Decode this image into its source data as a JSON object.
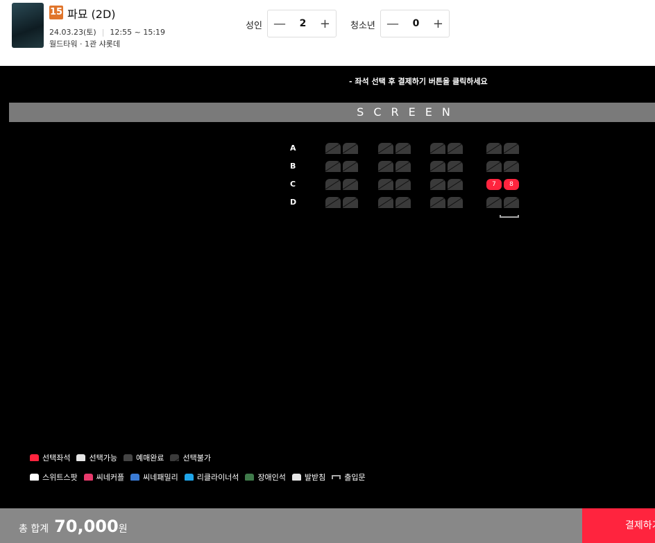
{
  "movie": {
    "rating": "15",
    "title": "파묘 (2D)",
    "date": "24.03.23(토)",
    "time": "12:55 ~ 15:19",
    "place": "월드타워 · 1관 샤롯데"
  },
  "tickets": {
    "adult_label": "성인",
    "adult_count": "2",
    "youth_label": "청소년",
    "youth_count": "0",
    "minus": "—",
    "plus": "+"
  },
  "notice": "-  좌석 선택 후 결제하기 버튼을 클릭하세요",
  "screen_label": "SCREEN",
  "seatmap": {
    "rows": [
      "A",
      "B",
      "C",
      "D"
    ],
    "selected": [
      {
        "row": "C",
        "num": "7"
      },
      {
        "row": "C",
        "num": "8"
      }
    ]
  },
  "legend": {
    "row1": [
      {
        "label": "선택좌석",
        "color": "#ff243e"
      },
      {
        "label": "선택가능",
        "color": "#e6e6e6"
      },
      {
        "label": "예매완료",
        "color": "#444444"
      },
      {
        "label": "선택불가",
        "color": "#3a3a3a"
      }
    ],
    "row2": [
      {
        "label": "스위트스팟",
        "color": "#ffffff"
      },
      {
        "label": "씨네커플",
        "color": "#e83a6c"
      },
      {
        "label": "씨네패밀리",
        "color": "#3a7bd5"
      },
      {
        "label": "리클라이너석",
        "color": "#1fa5ea"
      },
      {
        "label": "장애인석",
        "color": "#3f7a4a"
      },
      {
        "label": "발받침",
        "color": "#e6e6e6"
      },
      {
        "label": "출입문",
        "color": ""
      }
    ]
  },
  "footer": {
    "total_label": "총 합계",
    "amount": "70,000",
    "currency": "원",
    "pay_label": "결제하기"
  }
}
